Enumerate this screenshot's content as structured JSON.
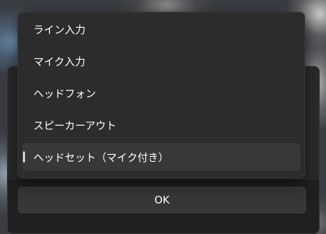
{
  "dialog": {
    "ok_label": "OK"
  },
  "dropdown": {
    "options": [
      {
        "label": "ライン入力",
        "selected": false
      },
      {
        "label": "マイク入力",
        "selected": false
      },
      {
        "label": "ヘッドフォン",
        "selected": false
      },
      {
        "label": "スピーカーアウト",
        "selected": false
      },
      {
        "label": "ヘッドセット（マイク付き）",
        "selected": true
      }
    ]
  }
}
